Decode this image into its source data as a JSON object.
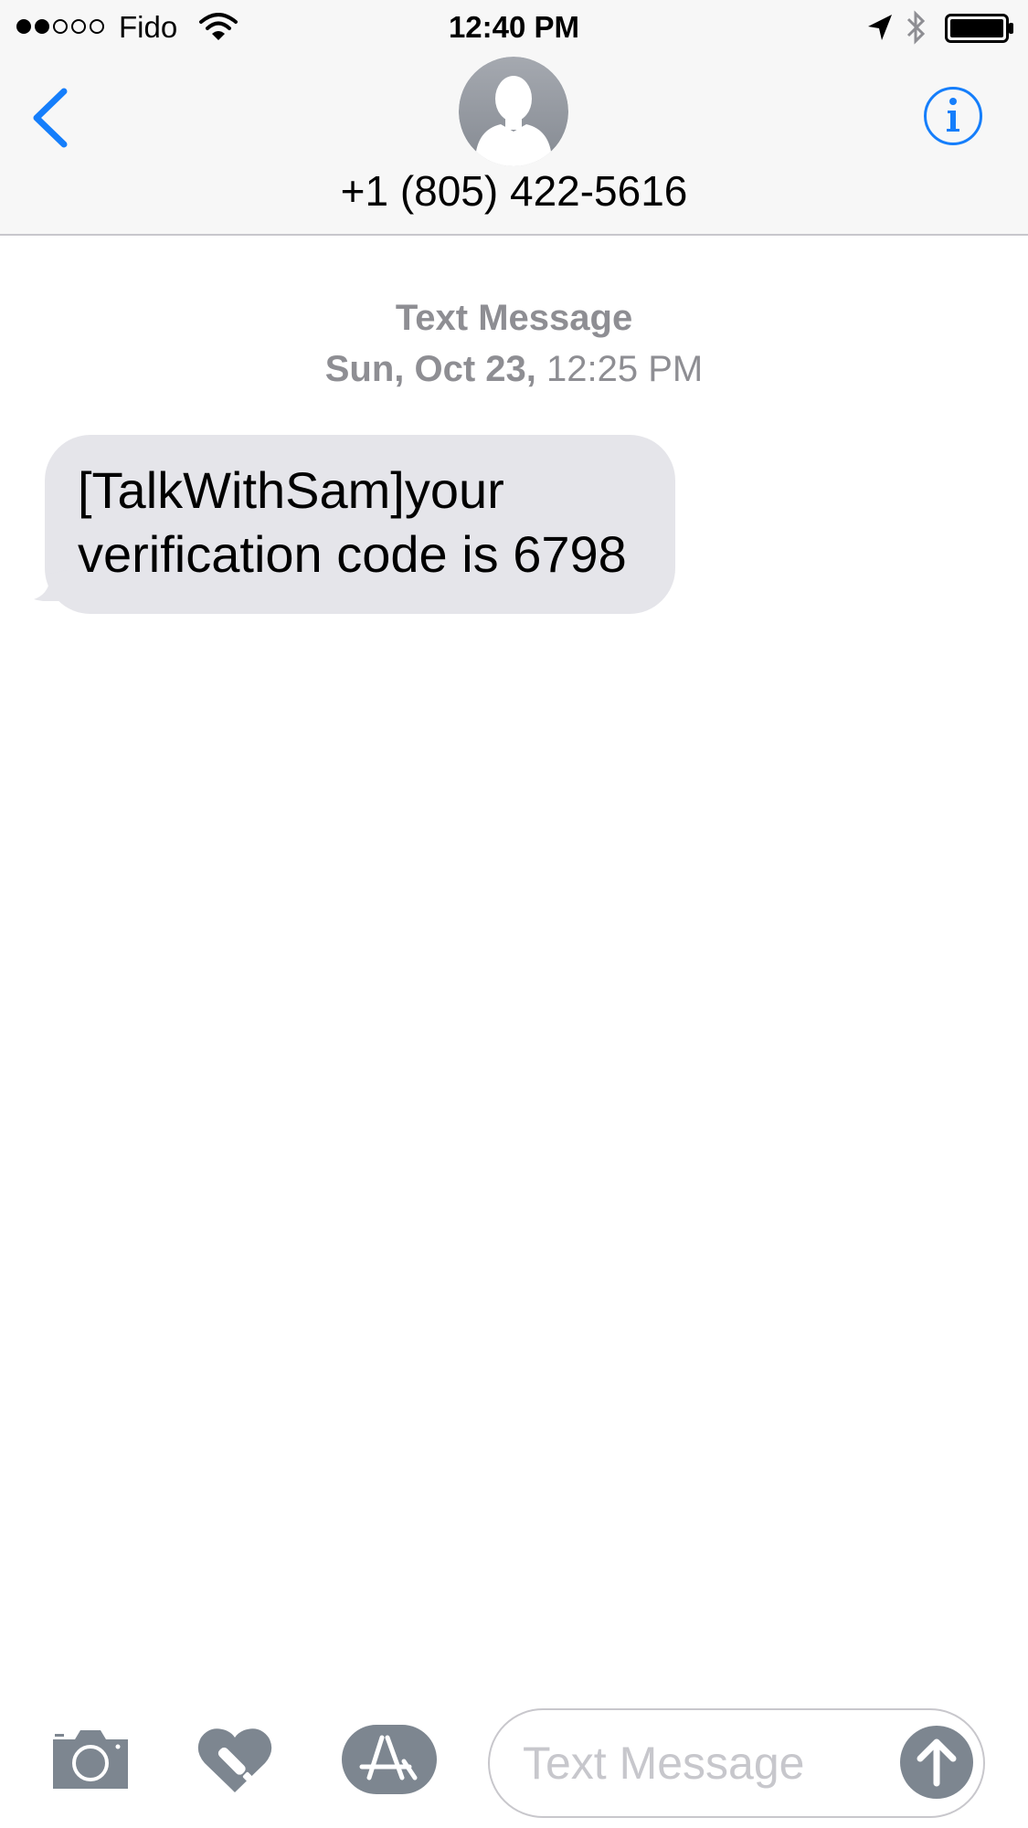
{
  "status_bar": {
    "carrier": "Fido",
    "time": "12:40 PM",
    "signal_bars_filled": 2,
    "signal_bars_total": 5,
    "icons": [
      "wifi-icon",
      "location-arrow-icon",
      "bluetooth-icon",
      "battery-icon"
    ]
  },
  "header": {
    "contact_number": "+1 (805) 422-5616",
    "icons": [
      "back-chevron-icon",
      "contact-avatar-icon",
      "info-icon"
    ]
  },
  "thread": {
    "label": "Text Message",
    "date": "Sun, Oct 23,",
    "time": "12:25 PM",
    "messages": [
      {
        "direction": "incoming",
        "text_line1": "[TalkWithSam]your",
        "text_line2": "verification code is 6798"
      }
    ]
  },
  "compose": {
    "placeholder": "Text Message",
    "icons": [
      "camera-icon",
      "digital-touch-icon",
      "app-store-icon",
      "send-arrow-icon"
    ]
  },
  "colors": {
    "accent": "#157efb",
    "bar_background": "#f7f7f7",
    "incoming_bubble": "#e5e5ea",
    "secondary_text": "#8e8e93",
    "icon_gray": "#7d8690"
  }
}
